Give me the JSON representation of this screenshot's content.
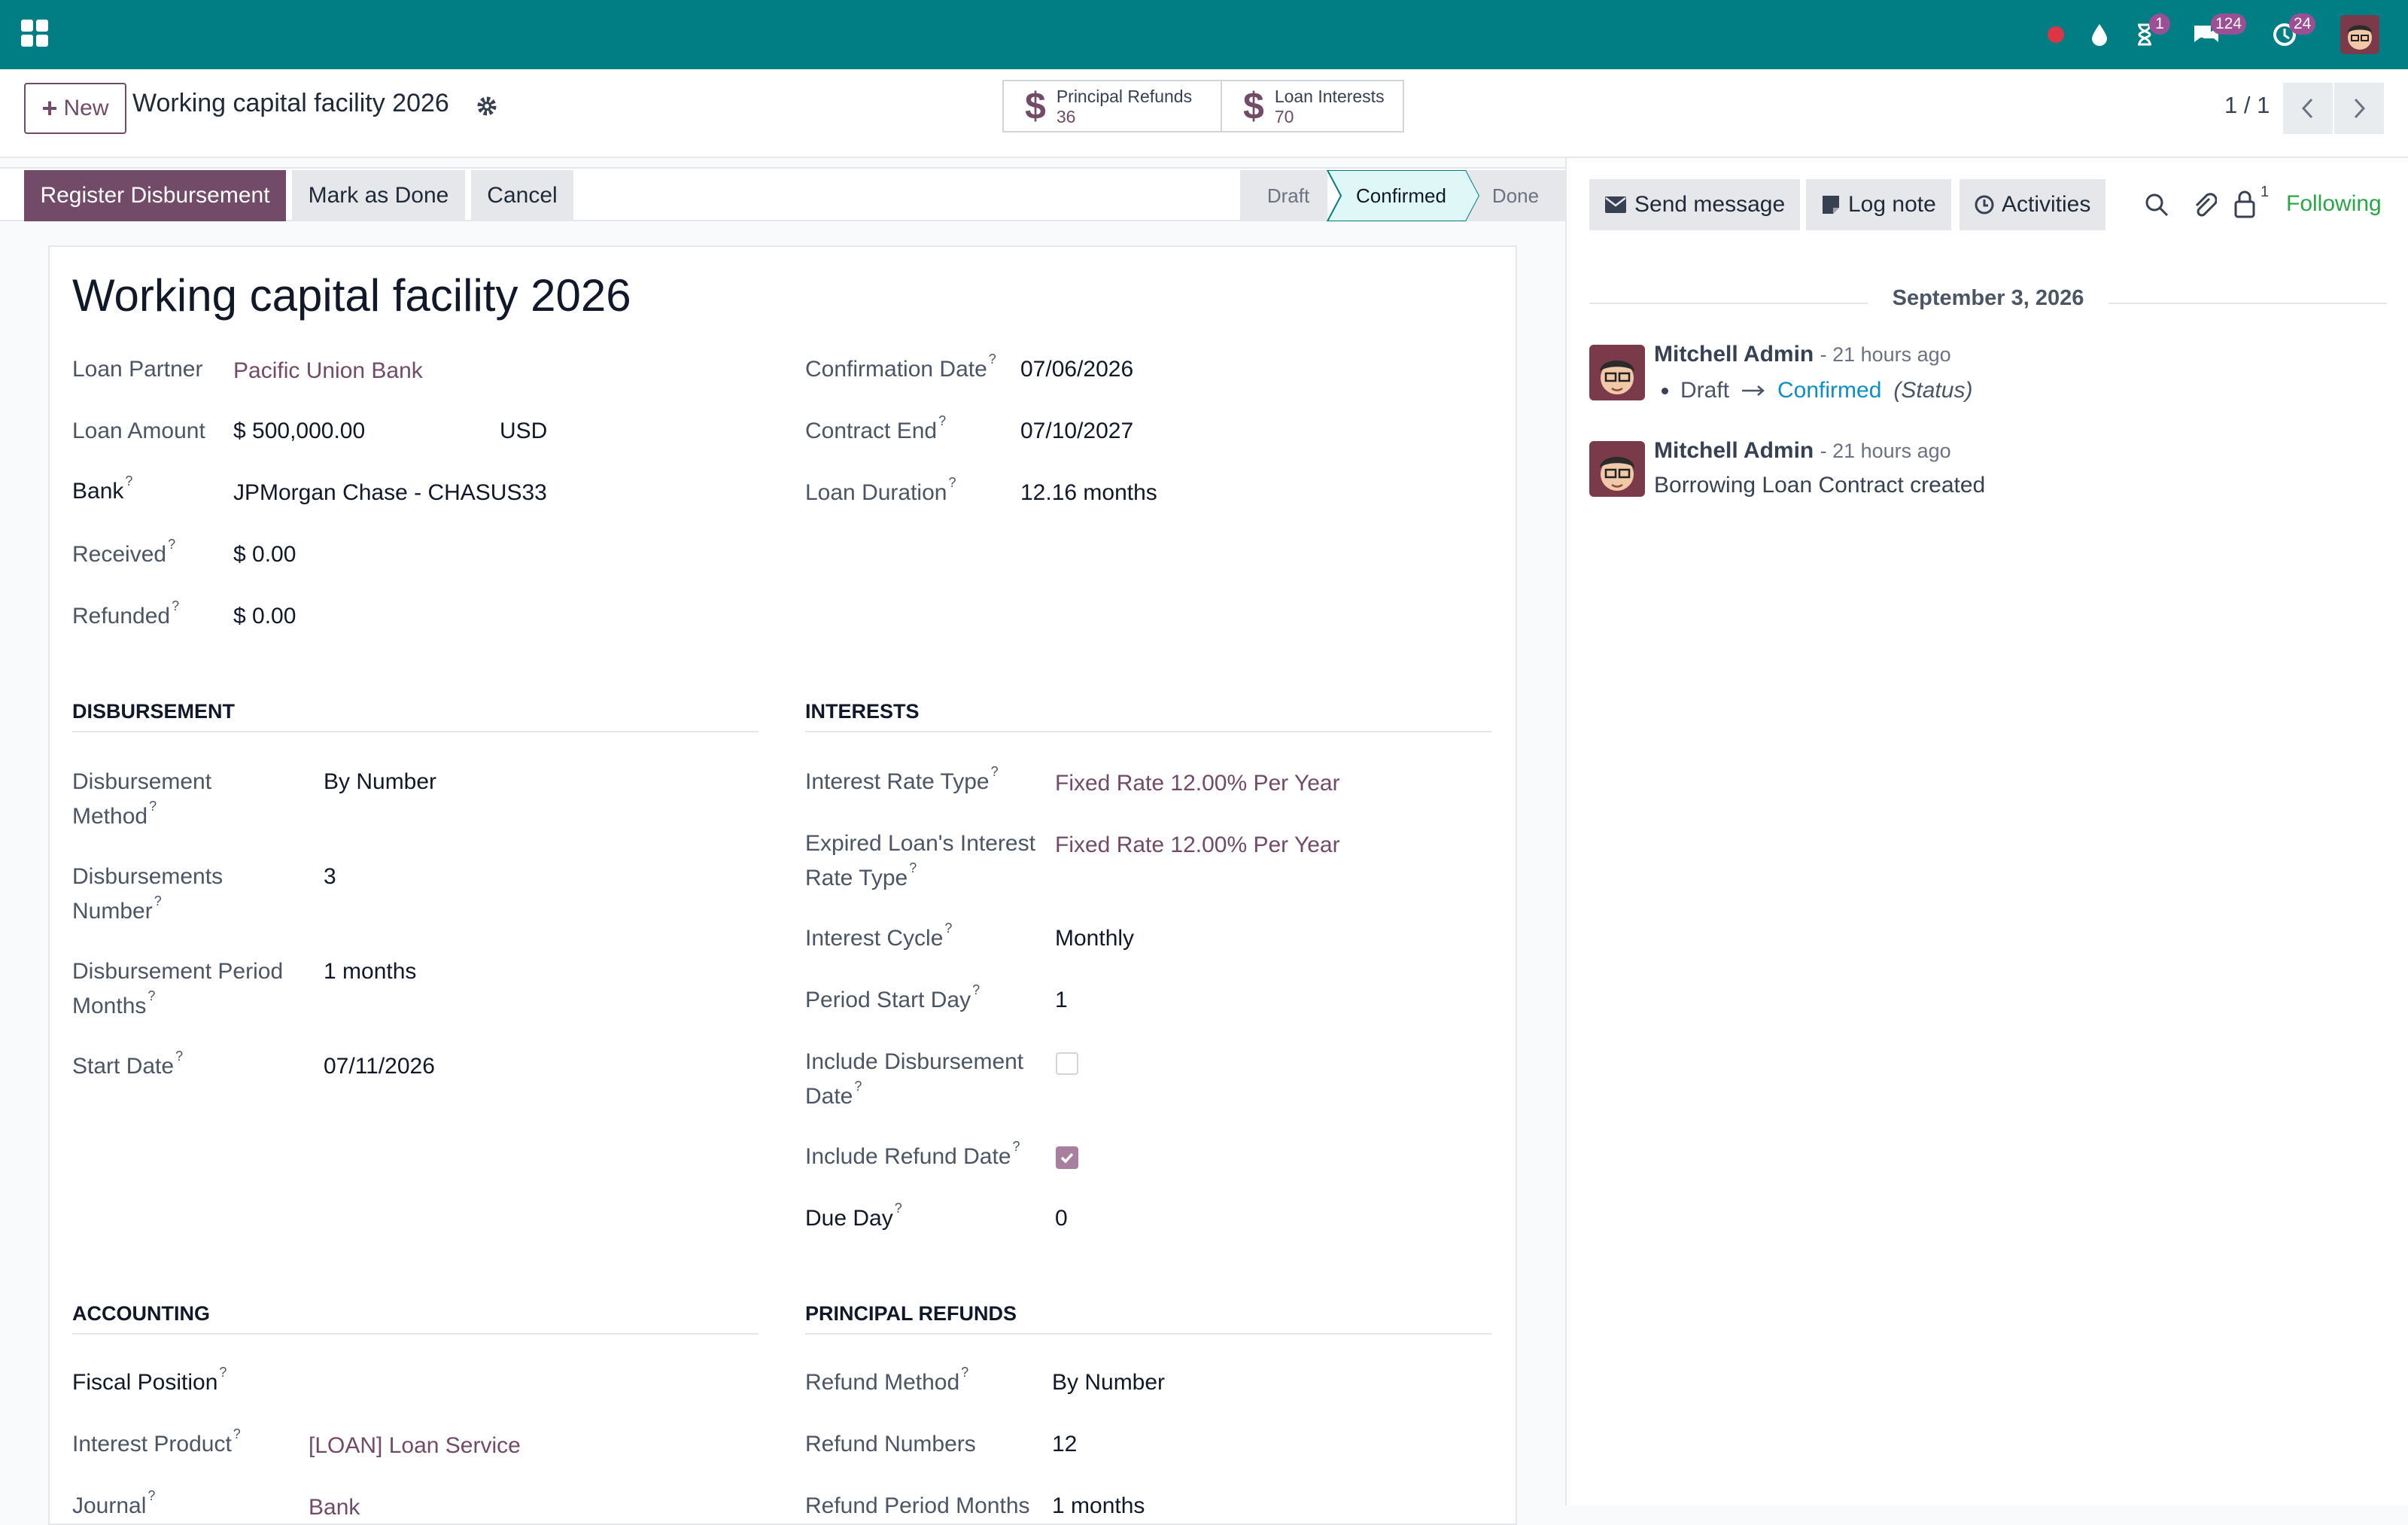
{
  "topbar": {
    "badges": {
      "activities": "1",
      "messages": "124",
      "updates": "24"
    }
  },
  "control": {
    "new_label": "New",
    "record_title": "Working capital facility 2026",
    "smart_buttons": [
      {
        "label": "Principal Refunds",
        "value": "36"
      },
      {
        "label": "Loan Interests",
        "value": "70"
      }
    ],
    "pager": "1 / 1"
  },
  "actions": {
    "register": "Register Disbursement",
    "mark_done": "Mark as Done",
    "cancel": "Cancel",
    "stages": [
      "Draft",
      "Confirmed",
      "Done"
    ],
    "active_stage": "Confirmed"
  },
  "form": {
    "title": "Working capital facility 2026",
    "left": [
      {
        "label": "Loan Partner",
        "value": "Pacific Union Bank"
      },
      {
        "label": "Loan Amount",
        "value": "$ 500,000.00",
        "currency": "USD"
      },
      {
        "label": "Bank",
        "value": "JPMorgan Chase - CHASUS33"
      },
      {
        "label": "Received",
        "value": "$ 0.00"
      },
      {
        "label": "Refunded",
        "value": "$ 0.00"
      }
    ],
    "right": [
      {
        "label": "Confirmation Date",
        "value": "07/06/2026"
      },
      {
        "label": "Contract End",
        "value": "07/10/2027"
      },
      {
        "label": "Loan Duration",
        "value": "12.16 months"
      }
    ],
    "disbursement": {
      "heading": "DISBURSEMENT",
      "fields": [
        {
          "label1": "Disbursement",
          "label2": "Method",
          "value": "By Number"
        },
        {
          "label1": "Disbursements",
          "label2": "Number",
          "value": "3"
        },
        {
          "label1": "Disbursement Period",
          "label2": "Months",
          "value": "1 months"
        },
        {
          "label1": "Start Date",
          "value": "07/11/2026"
        }
      ]
    },
    "interests": {
      "heading": "INTERESTS",
      "fields": [
        {
          "label1": "Interest Rate Type",
          "value": "Fixed Rate 12.00% Per Year"
        },
        {
          "label1": "Expired Loan's Interest",
          "label2": "Rate Type",
          "value": "Fixed Rate 12.00% Per Year"
        },
        {
          "label1": "Interest Cycle",
          "value": "Monthly"
        },
        {
          "label1": "Period Start Day",
          "value": "1"
        },
        {
          "label1": "Include Disbursement",
          "label2": "Date",
          "checked": false
        },
        {
          "label1": "Include Refund Date",
          "checked": true
        },
        {
          "label1": "Due Day",
          "value": "0"
        }
      ]
    },
    "accounting": {
      "heading": "ACCOUNTING",
      "fields": [
        {
          "label": "Fiscal Position",
          "value": ""
        },
        {
          "label": "Interest Product",
          "value": "[LOAN] Loan Service"
        },
        {
          "label": "Journal",
          "value": "Bank"
        }
      ]
    },
    "principal_refunds": {
      "heading": "PRINCIPAL REFUNDS",
      "fields": [
        {
          "label": "Refund Method",
          "value": "By Number"
        },
        {
          "label": "Refund Numbers",
          "value": "12"
        },
        {
          "label": "Refund Period Months",
          "value": "1 months"
        }
      ]
    }
  },
  "chatter": {
    "send_message": "Send message",
    "log_note": "Log note",
    "activities": "Activities",
    "followers_count": "1",
    "following": "Following",
    "date": "September 3, 2026",
    "messages": [
      {
        "author": "Mitchell Admin",
        "time": "- 21 hours ago",
        "old": "Draft",
        "new": "Confirmed",
        "field": "(Status)"
      },
      {
        "author": "Mitchell Admin",
        "time": "- 21 hours ago",
        "body": "Borrowing Loan Contract created"
      }
    ]
  },
  "colors": {
    "topbar": "#017e84",
    "primary": "#714b67",
    "link": "#714b67",
    "following": "#28a745"
  }
}
